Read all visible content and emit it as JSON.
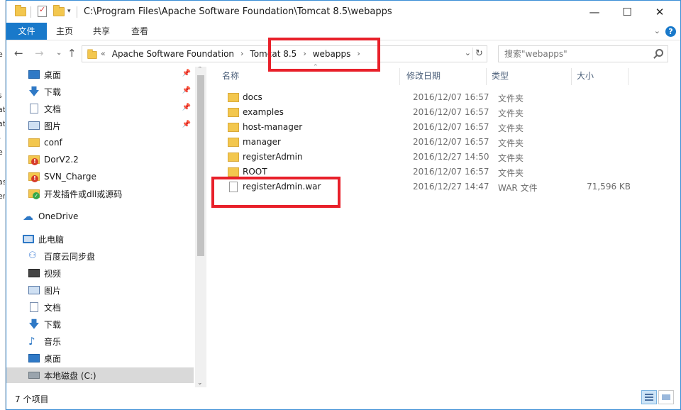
{
  "window": {
    "title_path": "C:\\Program Files\\Apache Software Foundation\\Tomcat 8.5\\webapps",
    "minimize": "—",
    "maximize": "☐",
    "close": "✕"
  },
  "ribbon": {
    "tabs": [
      "文件",
      "主页",
      "共享",
      "查看"
    ],
    "collapse": "⌄",
    "help": "?"
  },
  "address": {
    "overflow": "«",
    "crumbs": [
      "Apache Software Foundation",
      "Tomcat 8.5",
      "webapps"
    ],
    "sep": "›",
    "dropdown": "⌄",
    "refresh": "↻",
    "search_placeholder": "搜索\"webapps\""
  },
  "nav_buttons": {
    "back": "←",
    "forward": "→",
    "recent": "⌄",
    "up": "↑"
  },
  "nav": {
    "quick_access": [
      {
        "label": "桌面",
        "icon": "desktop-icon",
        "pinned": true
      },
      {
        "label": "下载",
        "icon": "download-icon",
        "pinned": true
      },
      {
        "label": "文档",
        "icon": "document-icon",
        "pinned": true
      },
      {
        "label": "图片",
        "icon": "pictures-icon",
        "pinned": true
      },
      {
        "label": "conf",
        "icon": "folder-icon",
        "pinned": false
      },
      {
        "label": "DorV2.2",
        "icon": "folder-error-icon",
        "pinned": false
      },
      {
        "label": "SVN_Charge",
        "icon": "folder-error-icon",
        "pinned": false
      },
      {
        "label": "开发插件或dll或源码",
        "icon": "folder-synced-icon",
        "pinned": false
      }
    ],
    "onedrive": "OneDrive",
    "this_pc": "此电脑",
    "pc_items": [
      {
        "label": "百度云同步盘",
        "icon": "baidu-sync-icon"
      },
      {
        "label": "视频",
        "icon": "videos-icon"
      },
      {
        "label": "图片",
        "icon": "pictures-icon"
      },
      {
        "label": "文档",
        "icon": "document-icon"
      },
      {
        "label": "下载",
        "icon": "download-icon"
      },
      {
        "label": "音乐",
        "icon": "music-icon"
      },
      {
        "label": "桌面",
        "icon": "desktop-icon"
      },
      {
        "label": "本地磁盘 (C:)",
        "icon": "local-disk-icon"
      }
    ],
    "pin_glyph": "📌"
  },
  "columns": {
    "name": "名称",
    "date": "修改日期",
    "type": "类型",
    "size": "大小"
  },
  "files": [
    {
      "name": "docs",
      "date": "2016/12/07 16:57",
      "type": "文件夹",
      "size": "",
      "kind": "folder"
    },
    {
      "name": "examples",
      "date": "2016/12/07 16:57",
      "type": "文件夹",
      "size": "",
      "kind": "folder"
    },
    {
      "name": "host-manager",
      "date": "2016/12/07 16:57",
      "type": "文件夹",
      "size": "",
      "kind": "folder"
    },
    {
      "name": "manager",
      "date": "2016/12/07 16:57",
      "type": "文件夹",
      "size": "",
      "kind": "folder"
    },
    {
      "name": "registerAdmin",
      "date": "2016/12/27 14:50",
      "type": "文件夹",
      "size": "",
      "kind": "folder"
    },
    {
      "name": "ROOT",
      "date": "2016/12/07 16:57",
      "type": "文件夹",
      "size": "",
      "kind": "folder"
    },
    {
      "name": "registerAdmin.war",
      "date": "2016/12/27 14:47",
      "type": "WAR 文件",
      "size": "71,596 KB",
      "kind": "file"
    }
  ],
  "status": {
    "item_count": "7 个项目"
  },
  "colors": {
    "accent": "#1979ca",
    "highlight_box": "#e8202a",
    "folder": "#f3c74e"
  }
}
